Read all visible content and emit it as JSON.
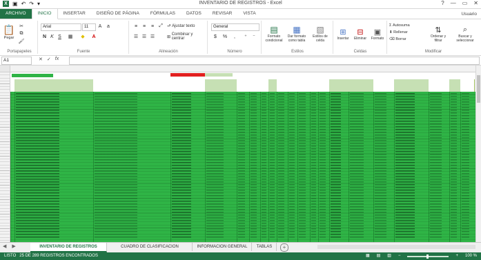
{
  "window": {
    "title": "INVENTARIO DE REGISTROS - Excel",
    "controls": [
      "?",
      "—",
      "▭",
      "✕"
    ]
  },
  "ribbon_tabs": [
    {
      "label": "ARCHIVO",
      "kind": "file"
    },
    {
      "label": "INICIO",
      "kind": "active"
    },
    {
      "label": "INSERTAR",
      "kind": "normal"
    },
    {
      "label": "DISEÑO DE PÁGINA",
      "kind": "normal"
    },
    {
      "label": "FÓRMULAS",
      "kind": "normal"
    },
    {
      "label": "DATOS",
      "kind": "normal"
    },
    {
      "label": "REVISAR",
      "kind": "normal"
    },
    {
      "label": "VISTA",
      "kind": "normal"
    }
  ],
  "user_label": "Usuario",
  "ribbon": {
    "clipboard": {
      "label": "Portapapeles",
      "paste": "Pegar"
    },
    "font": {
      "label": "Fuente",
      "font_name": "Arial",
      "font_size": "11"
    },
    "alignment": {
      "label": "Alineación",
      "wrap": "Ajustar texto",
      "merge": "Combinar y centrar"
    },
    "number": {
      "label": "Número",
      "format": "General"
    },
    "styles": {
      "label": "Estilos",
      "cond": "Formato condicional",
      "table": "Dar formato como tabla",
      "cell": "Estilos de celda"
    },
    "cells": {
      "label": "Celdas",
      "insert": "Insertar",
      "delete": "Eliminar",
      "format": "Formato"
    },
    "editing": {
      "label": "Modificar",
      "autosum": "Autosuma",
      "fill": "Rellenar",
      "clear": "Borrar",
      "sort": "Ordenar y filtrar",
      "find": "Buscar y seleccionar"
    }
  },
  "formula_bar": {
    "name_box": "A1",
    "content": ""
  },
  "sheet_tabs": [
    {
      "label": "INVENTARIO DE REGISTROS",
      "active": true
    },
    {
      "label": "CUADRO DE CLASIFICACION",
      "active": false
    },
    {
      "label": "INFORMACION GENERAL",
      "active": false
    },
    {
      "label": "TABLAS",
      "active": false
    }
  ],
  "status": {
    "left": "LISTO",
    "message": "25 DE 289 REGISTROS ENCONTRADOS",
    "zoom": "100 %"
  },
  "colors": {
    "accent": "#217346",
    "fill_green": "#2fb446",
    "header_green": "#c6e0b4",
    "red_marker": "#e21f1f"
  }
}
